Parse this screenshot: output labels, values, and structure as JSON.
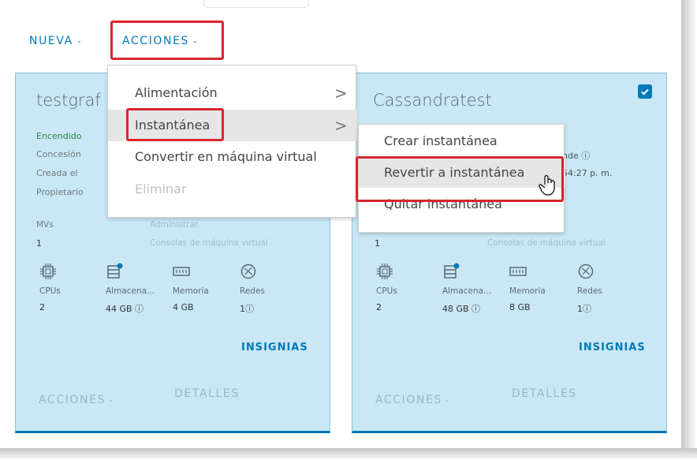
{
  "toolbar": {
    "nueva_label": "NUEVA",
    "acciones_label": "ACCIONES",
    "chevron": "⌄"
  },
  "actions_menu": {
    "items": [
      {
        "label": "Alimentación",
        "arrow": ">",
        "state": "normal"
      },
      {
        "label": "Instantánea",
        "arrow": ">",
        "state": "active"
      },
      {
        "label": "Convertir en máquina virtual",
        "state": "normal"
      },
      {
        "label": "Eliminar",
        "state": "disabled"
      }
    ]
  },
  "snapshot_submenu": {
    "items": [
      {
        "label": "Crear instantánea",
        "state": "normal"
      },
      {
        "label": "Revertir a instantánea",
        "state": "hover"
      },
      {
        "label": "Quitar instantánea",
        "state": "normal"
      }
    ]
  },
  "cards": [
    {
      "title": "testgraf",
      "status": "Encendido",
      "props": {
        "lease": "Concesión",
        "created": "Creada el",
        "owner": "Propietario"
      },
      "vms_label": "MVs",
      "vms_count": "1",
      "admin_link": "Administrar",
      "consoles_link": "Consolas de máquina virtual",
      "resources": [
        {
          "icon": "cpu-icon",
          "label": "CPUs",
          "value": "2"
        },
        {
          "icon": "storage-icon",
          "label": "Almacena...",
          "value": "44 GB ⓘ"
        },
        {
          "icon": "memory-icon",
          "label": "Memoria",
          "value": "4 GB"
        },
        {
          "icon": "network-icon",
          "label": "Redes",
          "value": "1ⓘ"
        }
      ],
      "insignias": "INSIGNIAS",
      "footer_actions": "ACCIONES",
      "footer_details": "DETALLES"
    },
    {
      "title": "Cassandratest",
      "lease_partial": "nde ⓘ",
      "created_partial": "54:27 p. m.",
      "selected": true,
      "vms_count": "1",
      "consoles_link": "Consolas de máquina virtual",
      "resources": [
        {
          "icon": "cpu-icon",
          "label": "CPUs",
          "value": "2"
        },
        {
          "icon": "storage-icon",
          "label": "Almacena...",
          "value": "48 GB ⓘ"
        },
        {
          "icon": "memory-icon",
          "label": "Memoria",
          "value": "8 GB"
        },
        {
          "icon": "network-icon",
          "label": "Redes",
          "value": "1ⓘ"
        }
      ],
      "insignias": "INSIGNIAS",
      "footer_actions": "ACCIONES",
      "footer_details": "DETALLES"
    }
  ],
  "colors": {
    "accent": "#0079b8",
    "card_bg": "#c9e7f5",
    "highlight": "#d9252f",
    "status_on": "#2e8540"
  }
}
